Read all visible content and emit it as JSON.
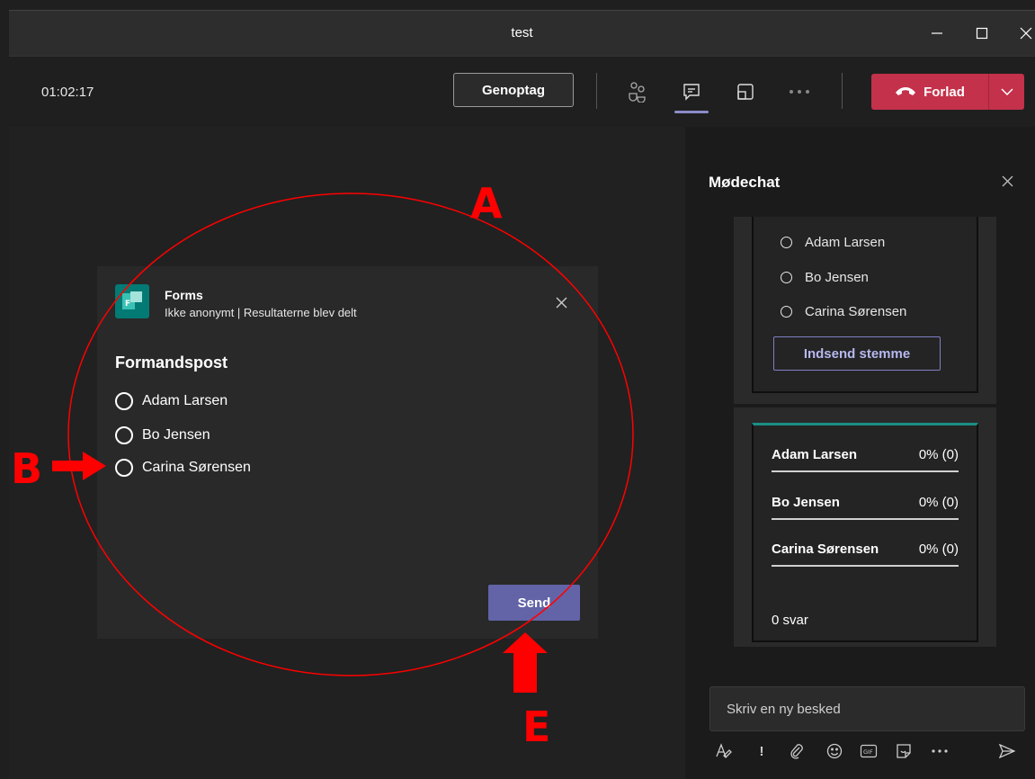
{
  "window": {
    "title": "test"
  },
  "meeting": {
    "timer": "01:02:17",
    "resume_label": "Genoptag",
    "leave_label": "Forlad"
  },
  "form": {
    "app_name": "Forms",
    "subtitle": "Ikke anonymt | Resultaterne blev delt",
    "question": "Formandspost",
    "options": [
      "Adam Larsen",
      "Bo Jensen",
      "Carina Sørensen"
    ],
    "send_label": "Send"
  },
  "chat": {
    "title": "Mødechat",
    "poll_options": [
      "Adam Larsen",
      "Bo Jensen",
      "Carina Sørensen"
    ],
    "submit_label": "Indsend stemme",
    "results": [
      {
        "name": "Adam Larsen",
        "percent_label": "0% (0)",
        "percent": 0
      },
      {
        "name": "Bo Jensen",
        "percent_label": "0% (0)",
        "percent": 0
      },
      {
        "name": "Carina Sørensen",
        "percent_label": "0% (0)",
        "percent": 0
      }
    ],
    "response_count": "0 svar",
    "compose_placeholder": "Skriv en ny besked"
  },
  "annotations": {
    "a": "A",
    "b": "B",
    "e": "E",
    "color": "#ff0000"
  },
  "colors": {
    "leave": "#c4314b",
    "accent": "#6264a7",
    "forms": "#037a74"
  }
}
